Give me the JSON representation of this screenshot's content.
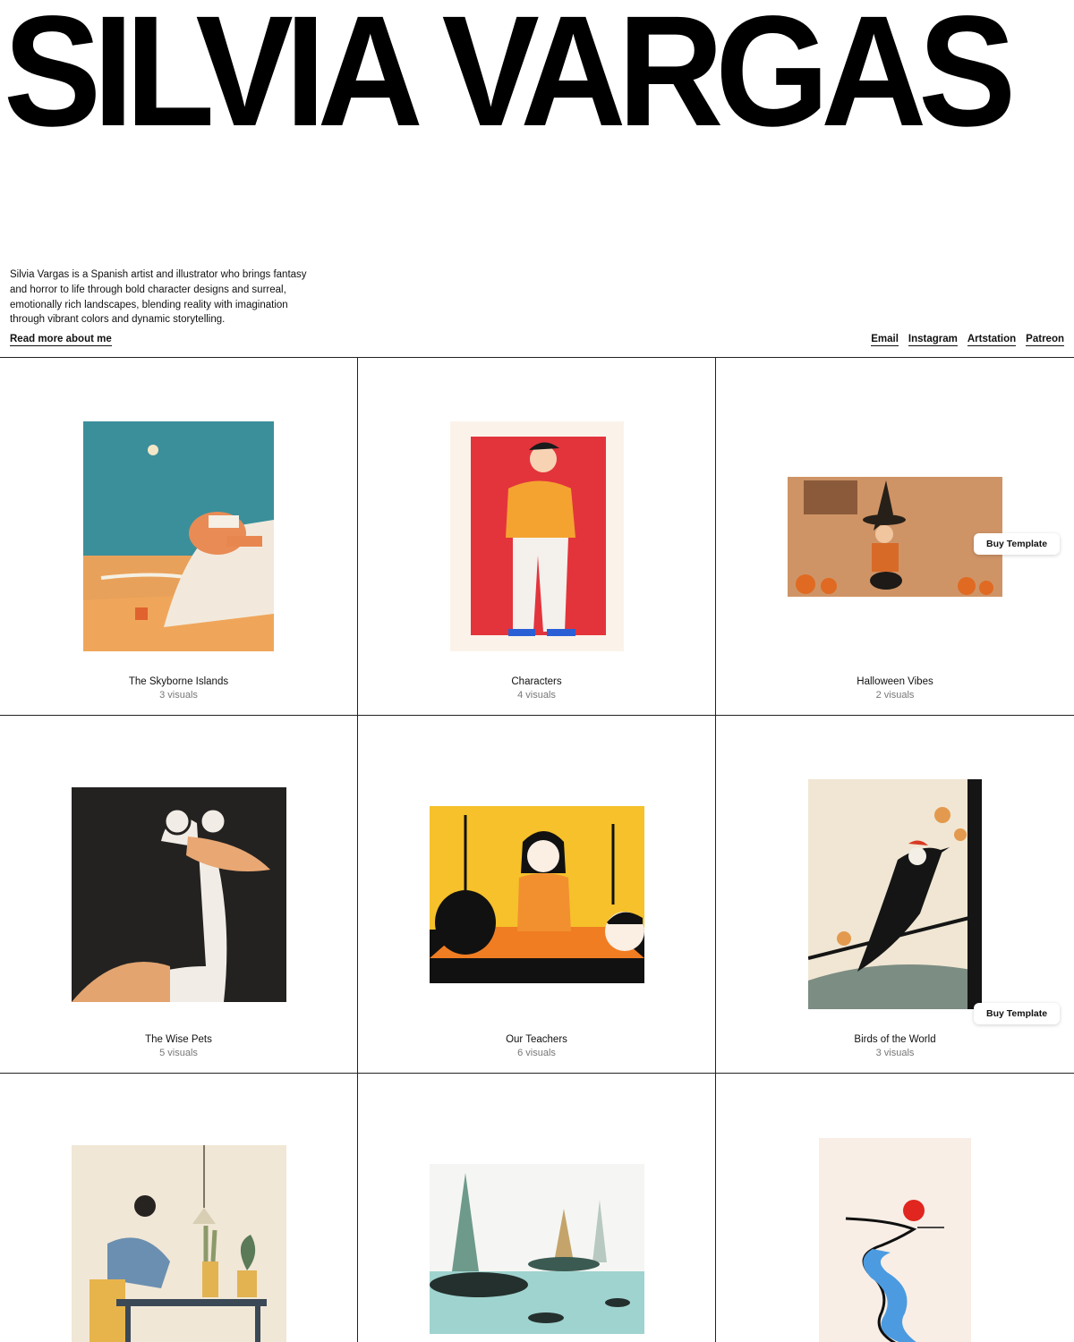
{
  "header": {
    "title": "SILVIA VARGAS",
    "bio": "Silvia Vargas is a Spanish artist and illustrator who brings fantasy and horror to life through bold character designs and surreal, emotionally rich landscapes, blending reality with imagination through vibrant colors and dynamic storytelling.",
    "read_more": "Read more about me",
    "links": [
      "Email",
      "Instagram",
      "Artstation",
      "Patreon"
    ]
  },
  "buy_label": "Buy Template",
  "projects": [
    {
      "title": "The Skyborne Islands",
      "count": "3 visuals"
    },
    {
      "title": "Characters",
      "count": "4 visuals"
    },
    {
      "title": "Halloween Vibes",
      "count": "2 visuals"
    },
    {
      "title": "The Wise Pets",
      "count": "5 visuals"
    },
    {
      "title": "Our Teachers",
      "count": "6 visuals"
    },
    {
      "title": "Birds of the World",
      "count": "3 visuals"
    },
    {
      "title": "",
      "count": ""
    },
    {
      "title": "",
      "count": ""
    },
    {
      "title": "",
      "count": ""
    }
  ],
  "colors": {
    "ink": "#000000",
    "border": "#222222",
    "muted": "#777777"
  }
}
